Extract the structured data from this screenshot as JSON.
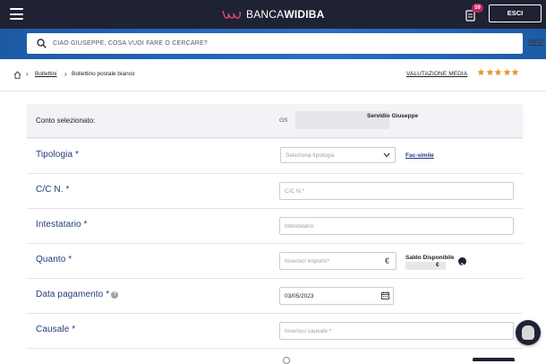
{
  "header": {
    "brand_prefix": "BANCA",
    "brand_bold": "WIDIBA",
    "notification_count": "59",
    "exit_label": "ESCI"
  },
  "search": {
    "placeholder": "CIAO GIUSEPPE, COSA VUOI FARE O CERCARE?",
    "info_label": "INFO"
  },
  "breadcrumb": {
    "items": [
      "Bollettini",
      "Bollettino postale bianco"
    ],
    "rating_label": "VALUTAZIONE MEDIA",
    "rating_stars": 5
  },
  "account": {
    "label": "Conto selezionato:",
    "abbr": "GS",
    "holder": "Servidio Giuseppe"
  },
  "form": {
    "tipologia": {
      "label": "Tipologia *",
      "placeholder": "Seleziona tipologia",
      "facsimile": "Fac-simile"
    },
    "cc": {
      "label": "C/C N. *",
      "placeholder": "C/C N.*"
    },
    "intestatario": {
      "label": "Intestatario *",
      "placeholder": "Intestatario"
    },
    "quanto": {
      "label": "Quanto *",
      "placeholder": "Inserisci importo*",
      "currency": "€",
      "saldo_label": "Saldo Disponibile",
      "saldo_currency": "€"
    },
    "data": {
      "label": "Data pagamento *",
      "value": "03/05/2023",
      "help": "?"
    },
    "causale": {
      "label": "Causale *",
      "placeholder": "Inserisci causale *"
    }
  },
  "colors": {
    "header_bg": "#1f2233",
    "search_band": "#2a6fc0",
    "label_blue": "#1f3a7a",
    "brand_pink": "#c0225e",
    "star_orange": "#e8962a"
  }
}
